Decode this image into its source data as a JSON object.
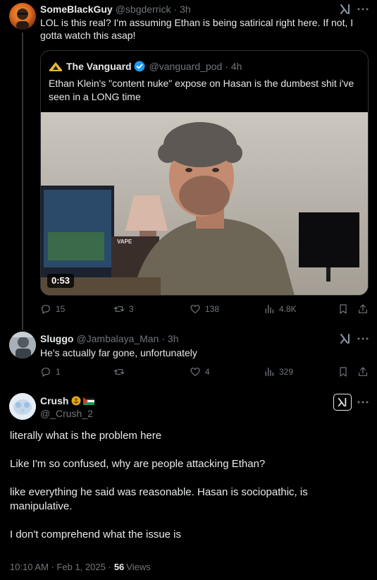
{
  "tweet1": {
    "name": "SomeBlackGuy",
    "handle": "@sbgderrick",
    "time": "· 3h",
    "text": "LOL is this real? I'm assuming Ethan is being satirical right here. If not, I gotta watch this asap!",
    "quote": {
      "name": "The Vanguard",
      "handle": "@vanguard_pod",
      "time": "· 4h",
      "text": "Ethan Klein's \"content nuke\" expose on Hasan is the dumbest shit i've seen in a LONG time",
      "video_duration": "0:53",
      "video_tag": "VAPE"
    },
    "stats": {
      "replies": "15",
      "reposts": "3",
      "likes": "138",
      "views": "4.8K"
    }
  },
  "tweet2": {
    "name": "Sluggo",
    "handle": "@Jambalaya_Man",
    "time": "· 3h",
    "text": "He's actually far gone, unfortunately",
    "stats": {
      "replies": "1",
      "reposts": "",
      "likes": "4",
      "views": "329"
    }
  },
  "main": {
    "name": "Crush",
    "handle": "@_Crush_2",
    "paragraphs": [
      "literally what is the problem here",
      "Like I'm so confused, why are people attacking Ethan?",
      "like everything he said was reasonable. Hasan is sociopathic, is manipulative.",
      "I don't comprehend what the issue is"
    ],
    "timestamp": "10:10 AM · Feb 1, 2025 ·",
    "views_count": "56",
    "views_label": "Views"
  },
  "icons": {
    "grok": "grok-icon",
    "more": "more-icon",
    "reply": "reply-icon",
    "repost": "repost-icon",
    "like": "like-icon",
    "views": "views-icon",
    "bookmark": "bookmark-icon",
    "share": "share-icon",
    "verified": "verified-badge-icon"
  },
  "colors": {
    "background": "#000000",
    "text": "#e7e9ea",
    "muted": "#71767b",
    "border": "#2f3336",
    "verified": "#1d9bf0"
  }
}
